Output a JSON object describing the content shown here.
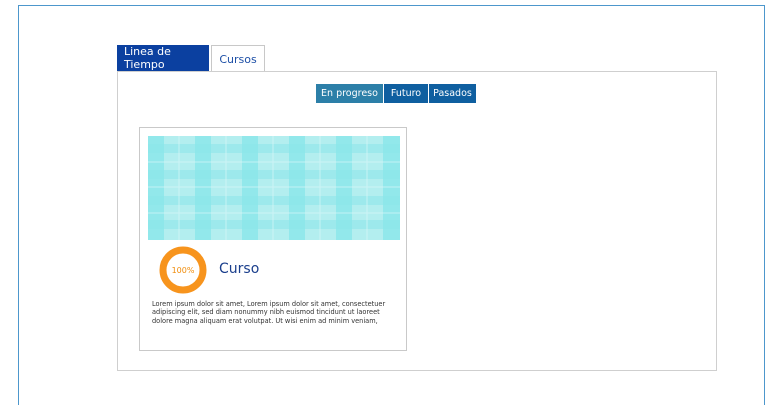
{
  "tabs": [
    {
      "label": "Linea de Tiempo",
      "active": true
    },
    {
      "label": "Cursos",
      "active": false
    }
  ],
  "filters": [
    {
      "label": "En progreso",
      "selected": true
    },
    {
      "label": "Futuro",
      "selected": false
    },
    {
      "label": "Pasados",
      "selected": false
    }
  ],
  "course_card": {
    "progress_label": "100%",
    "progress_percent": 100,
    "title": "Curso",
    "description": "Lorem ipsum dolor sit amet, Lorem ipsum dolor sit amet, consectetuer adipiscing elit, sed diam nonummy nibh euismod tincidunt ut laoreet dolore magna aliquam erat volutpat. Ut wisi enim ad minim veniam,"
  },
  "colors": {
    "active_tab": "#0b40a0",
    "filter_selected": "#2c7fa8",
    "filter_default": "#0f5fa0",
    "progress_ring": "#f7941d",
    "card_image_light": "#b3eeef",
    "card_image_band": "#8ae6ea",
    "frame_border": "#4d97cc"
  }
}
